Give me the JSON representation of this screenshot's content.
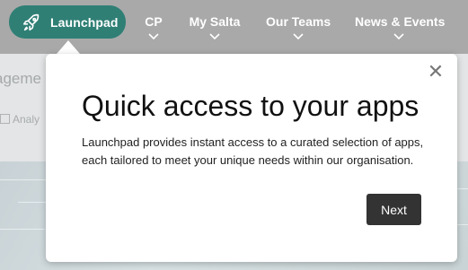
{
  "nav": {
    "launchpad_label": "Launchpad",
    "items": [
      {
        "label": "CP"
      },
      {
        "label": "My Salta"
      },
      {
        "label": "Our Teams"
      },
      {
        "label": "News & Events"
      }
    ]
  },
  "background": {
    "title_fragment": "ageme",
    "sub_fragment": "Analy"
  },
  "popover": {
    "title": "Quick access to your apps",
    "body": "Launchpad provides instant access to a curated selection of apps, each tailored to meet your unique needs within our organisation.",
    "next_label": "Next",
    "close_glyph": "✕"
  },
  "colors": {
    "accent": "#2f7f75",
    "nav_bg": "#a9a9a9",
    "button_bg": "#333333"
  }
}
